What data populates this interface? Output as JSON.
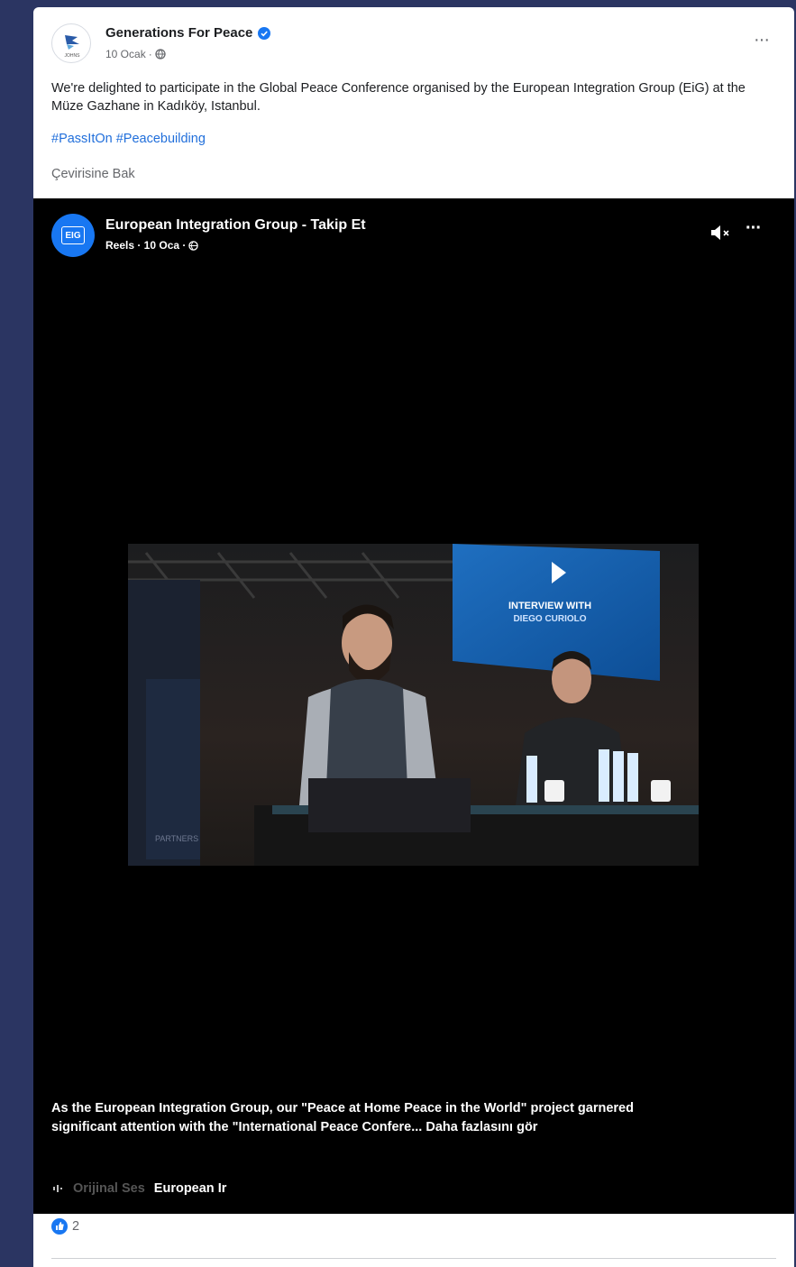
{
  "post": {
    "author": "Generations For Peace",
    "date": "10 Ocak",
    "separator": "·",
    "text": "We're delighted to participate in the Global Peace Conference organised by the European Integration Group (EiG) at the Müze Gazhane in Kadıköy, Istanbul.",
    "hashtags": [
      "#PassItOn",
      "#Peacebuilding"
    ],
    "translate_label": "Çevirisine Bak",
    "more_label": "···",
    "avatar_caption": "JOHNS"
  },
  "video": {
    "channel_title": "European Integration Group - Takip Et",
    "meta": "Reels · 10 Oca ·",
    "avatar_text": "EIG",
    "more_label": "···",
    "frame_texts": {
      "screen_line1": "INTERVIEW WITH",
      "screen_line2": "DIEGO CURIOLO",
      "partners": "PARTNERS"
    },
    "caption": "As the European Integration Group, our \"Peace at Home Peace in the World\" project garnered significant attention with the \"International Peace Confere...",
    "see_more": "Daha fazlasını gör",
    "audio_label": "Orijinal Ses",
    "audio_source": "European Ir"
  },
  "reactions": {
    "count": "2"
  },
  "colors": {
    "accent": "#1877f2",
    "link": "#216fdb",
    "background": "#2b3562"
  },
  "icons": [
    "verified-icon",
    "globe-icon",
    "mute-icon",
    "audio-wave-icon",
    "like-icon"
  ]
}
